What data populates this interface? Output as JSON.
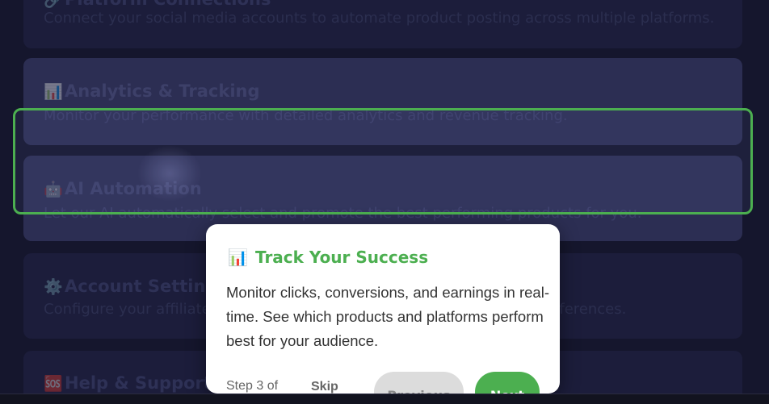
{
  "cards": [
    {
      "icon": "link-icon",
      "emoji": "🔗",
      "title": "Platform Connections",
      "desc": "Connect your social media accounts to automate product posting across multiple platforms."
    },
    {
      "icon": "chart-icon",
      "emoji": "📊",
      "title": "Analytics & Tracking",
      "desc": "Monitor your performance with detailed analytics and revenue tracking."
    },
    {
      "icon": "robot-icon",
      "emoji": "🤖",
      "title": "AI Automation",
      "desc": "Let our AI automatically select and promote the best performing products for you."
    },
    {
      "icon": "gear-icon",
      "emoji": "⚙️",
      "title": "Account Settings",
      "desc": "Configure your affiliate accounts, payment details, and notification preferences."
    },
    {
      "icon": "sos-icon",
      "emoji": "🆘",
      "title": "Help & Support",
      "desc": ""
    }
  ],
  "tour": {
    "emoji": "📊",
    "title": "Track Your Success",
    "body": "Monitor clicks, conversions, and earnings in real-time. See which products and platforms perform best for your audience.",
    "step": "Step 3 of",
    "skip": "Skip",
    "previous": "Previous",
    "next": "Next"
  },
  "colors": {
    "accent": "#4caf50",
    "background": "#1b1c36",
    "card": "#24264a"
  }
}
